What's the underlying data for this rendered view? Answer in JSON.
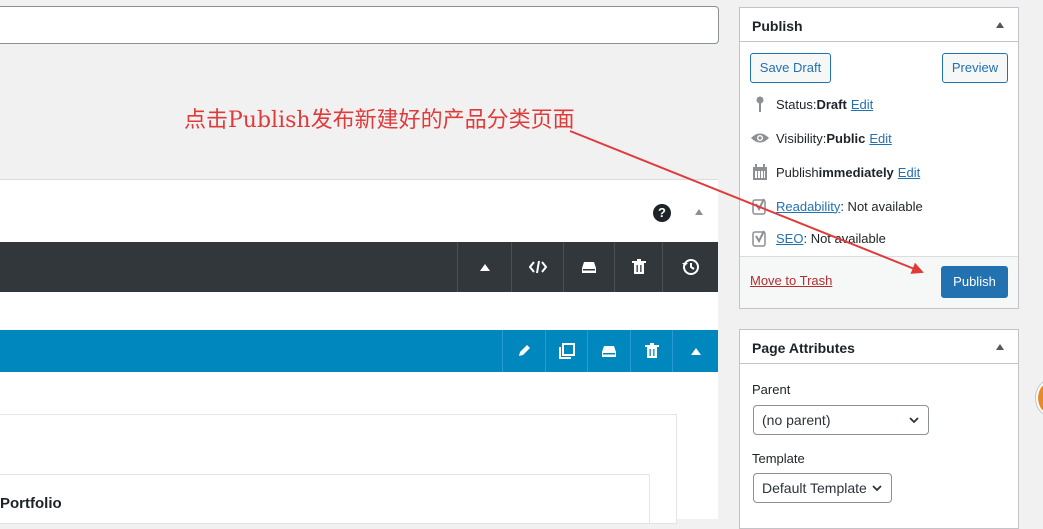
{
  "annotation": {
    "text": "点击Publish发布新建好的产品分类页面"
  },
  "builder": {
    "help_label": "?",
    "dark_toolbar": [
      "collapse-up",
      "code",
      "save-template",
      "delete",
      "history"
    ],
    "blue_toolbar": [
      "edit",
      "clone",
      "save",
      "delete",
      "collapse-up"
    ],
    "portfolio_label": "Portfolio"
  },
  "publish_box": {
    "title": "Publish",
    "save_draft": "Save Draft",
    "preview": "Preview",
    "status_label": "Status: ",
    "status_value": "Draft",
    "status_edit": "Edit",
    "visibility_label": "Visibility: ",
    "visibility_value": "Public",
    "visibility_edit": "Edit",
    "publish_label": "Publish ",
    "publish_value": "immediately",
    "publish_edit": "Edit",
    "readability_link": "Readability",
    "readability_value": ": Not available",
    "seo_link": "SEO",
    "seo_value": ": Not available",
    "move_to_trash": "Move to Trash",
    "publish_button": "Publish"
  },
  "page_attributes": {
    "title": "Page Attributes",
    "parent_label": "Parent",
    "parent_value": "(no parent)",
    "template_label": "Template",
    "template_value": "Default Template"
  },
  "colors": {
    "primary": "#2271b1",
    "annotation_red": "#e03b3b",
    "toolbar_dark": "#32373c",
    "toolbar_blue": "#0087be",
    "trash_red": "#b32d2e"
  }
}
